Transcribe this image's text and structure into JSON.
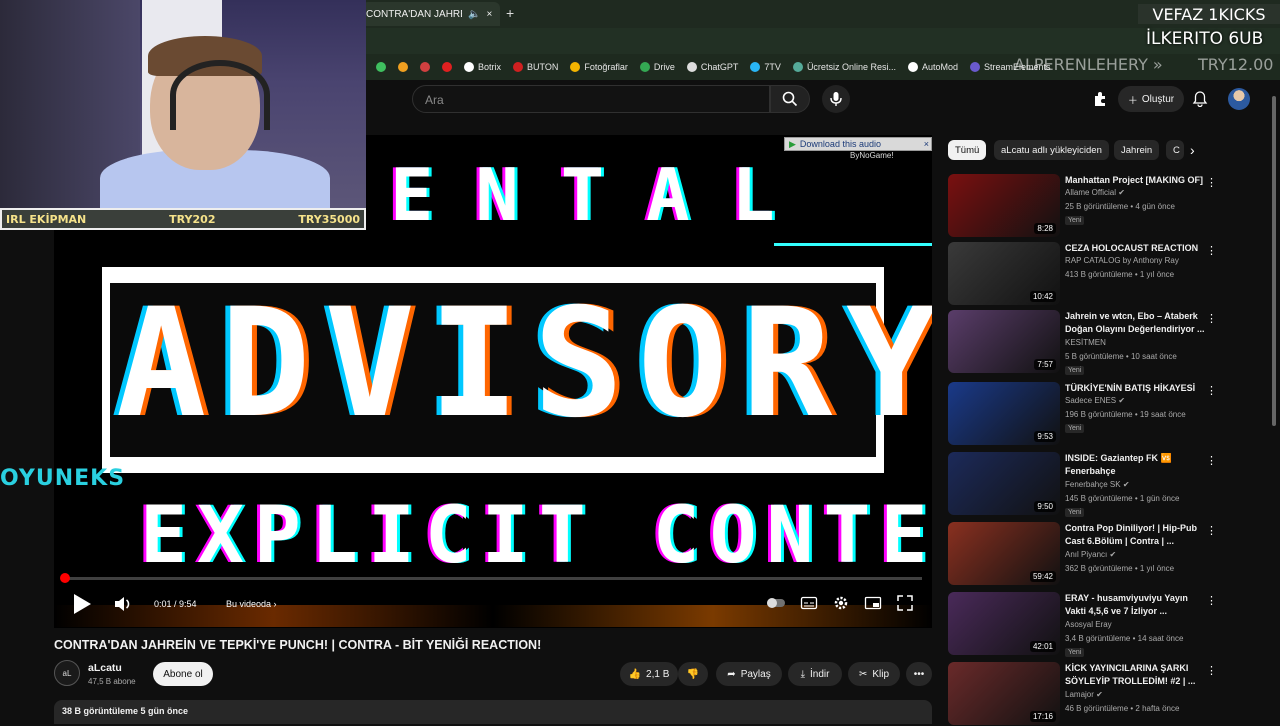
{
  "browser": {
    "tab_title": "CONTRA'DAN JAHREİN VE",
    "tab_close": "×",
    "new_tab": "+",
    "bookmarks": [
      {
        "label": "",
        "icon": "green-app-icon",
        "color": "#3fbf5f"
      },
      {
        "label": "",
        "icon": "orange-app-icon",
        "color": "#f0a020"
      },
      {
        "label": "",
        "icon": "twitch-icon",
        "color": "#d04040"
      },
      {
        "label": "",
        "icon": "red-circle-icon",
        "color": "#e02020"
      },
      {
        "label": "Botrix",
        "icon": "botrix-icon",
        "color": "#ffffff"
      },
      {
        "label": "BUTON",
        "icon": "buton-icon",
        "color": "#d02020"
      },
      {
        "label": "Fotoğraflar",
        "icon": "photos-icon",
        "color": "#f4b400"
      },
      {
        "label": "Drive",
        "icon": "drive-icon",
        "color": "#34a853"
      },
      {
        "label": "ChatGPT",
        "icon": "chatgpt-icon",
        "color": "#dddddd"
      },
      {
        "label": "7TV",
        "icon": "7tv-icon",
        "color": "#29b6f6"
      },
      {
        "label": "Ücretsiz Online Resi...",
        "icon": "rp-icon",
        "color": "#5a9"
      },
      {
        "label": "AutoMod",
        "icon": "automod-icon",
        "color": "#ffffff"
      },
      {
        "label": "StreamElements",
        "icon": "streamelements-icon",
        "color": "#6a5acd"
      }
    ]
  },
  "overlay": {
    "top_right": "VEFAZ 1KICKS",
    "sub_line": "İLKERITO 6UB",
    "alp_line": "ALPERENLEHERY »",
    "try_line": "TRY12.00",
    "irl_left": "IRL EKİPMAN",
    "irl_mid": "TRY202",
    "irl_right": "TRY35000",
    "sponsor": "OYUNEKS"
  },
  "header": {
    "search_placeholder": "Ara",
    "create_label": "Oluştur"
  },
  "player": {
    "line1": "PARENTAL",
    "line2": "ADVISORY",
    "line3": "EXPLICIT CONTENT",
    "download_audio": "Download this audio",
    "download_close": "×",
    "bynogame": "ByNoGame!",
    "time": "0:01 / 9:54",
    "chapter": "Bu videoda ›",
    "progress": 0.002
  },
  "video": {
    "title": "CONTRA'DAN JAHREİN VE TEPKİ'YE PUNCH! | CONTRA - BİT YENİĞİ REACTION!",
    "channel": "aLcatu",
    "channel_avatar_text": "aL",
    "subs": "47,5 B abone",
    "subscribe": "Abone ol",
    "likes": "2,1 B",
    "share": "Paylaş",
    "download": "İndir",
    "clip": "Klip",
    "more": "•••",
    "desc": "38 B görüntüleme  5 gün önce"
  },
  "chips": [
    "Tümü",
    "aLcatu adlı yükleyiciden",
    "Jahrein",
    "C"
  ],
  "related": [
    {
      "title": "Manhattan Project [MAKING OF]",
      "channel": "Allame Official ✔",
      "meta": "25 B görüntüleme • 4 gün önce",
      "badge": "Yeni",
      "duration": "8:28",
      "thumb": "#7a1010"
    },
    {
      "title": "CEZA HOLOCAUST REACTION",
      "channel": "RAP CATALOG by Anthony Ray",
      "meta": "413 B görüntüleme • 1 yıl önce",
      "badge": "",
      "duration": "10:42",
      "thumb": "#3a3a3a"
    },
    {
      "title": "Jahrein ve wtcn, Ebo – Ataberk Doğan Olayını Değerlendiriyor ...",
      "channel": "KESİTMEN",
      "meta": "5 B görüntüleme • 10 saat önce",
      "badge": "Yeni",
      "duration": "7:57",
      "thumb": "#5a3d6a"
    },
    {
      "title": "TÜRKİYE'NİN BATIŞ HİKAYESİ",
      "channel": "Sadece ENES ✔",
      "meta": "196 B görüntüleme • 19 saat önce",
      "badge": "Yeni",
      "duration": "9:53",
      "thumb": "#1a3a8a"
    },
    {
      "title": "INSIDE: Gaziantep FK 🆚 Fenerbahçe",
      "channel": "Fenerbahçe SK ✔",
      "meta": "145 B görüntüleme • 1 gün önce",
      "badge": "Yeni",
      "duration": "9:50",
      "thumb": "#1c2a5a"
    },
    {
      "title": "Contra Pop Diniliyor! | Hip-Pub Cast 6.Bölüm | Contra | ...",
      "channel": "Anıl Piyancı ✔",
      "meta": "362 B görüntüleme • 1 yıl önce",
      "badge": "",
      "duration": "59:42",
      "thumb": "#8a3020"
    },
    {
      "title": "ERAY - husamviyuviyu Yayın Vakti 4,5,6 ve 7 İzliyor ...",
      "channel": "Asosyal Eray",
      "meta": "3,4 B görüntüleme • 14 saat önce",
      "badge": "Yeni",
      "duration": "42:01",
      "thumb": "#4a2a5a"
    },
    {
      "title": "KİCK YAYINCILARINA ŞARKI SÖYLEYİP TROLLEDİM! #2 | ...",
      "channel": "Lamajor ✔",
      "meta": "46 B görüntüleme • 2 hafta önce",
      "badge": "",
      "duration": "17:16",
      "thumb": "#6a2a2a"
    }
  ]
}
